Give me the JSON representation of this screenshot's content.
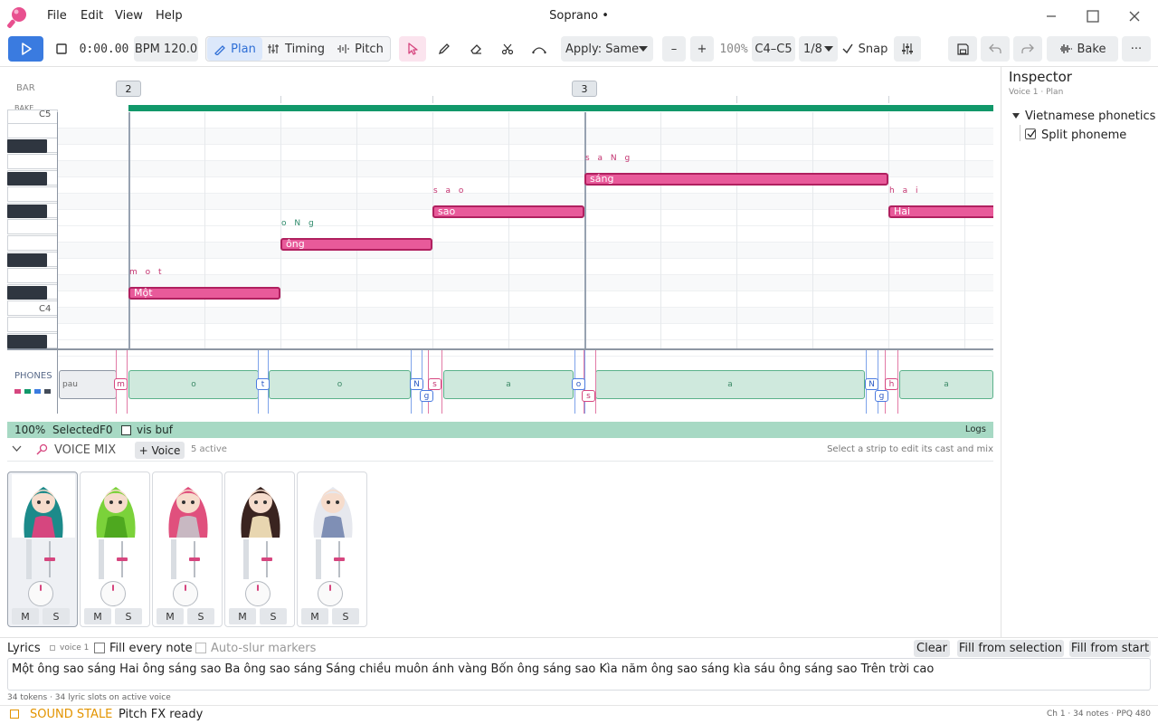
{
  "app": {
    "title": "Soprano •",
    "menu": [
      "File",
      "Edit",
      "View",
      "Help"
    ]
  },
  "toolbar": {
    "time": "0:00.00",
    "bpm": "BPM 120.0",
    "modes": [
      "Plan",
      "Timing",
      "Pitch"
    ],
    "active_mode": "Plan",
    "apply": "Apply: Same",
    "zoom_minus": "–",
    "zoom_plus": "+",
    "zoom": "100%",
    "range": "C4–C5",
    "division": "1/8",
    "snap_label": "Snap",
    "snap_checked": true,
    "bake_label": "Bake",
    "more": "···"
  },
  "icons": {
    "play": "play-icon",
    "stop": "stop-icon",
    "pointer": "pointer-icon",
    "pencil": "pencil-icon",
    "eraser": "eraser-icon",
    "scissors": "scissors-icon",
    "curve": "curve-icon",
    "sliders": "sliders-icon",
    "save": "save-icon",
    "undo": "undo-icon",
    "redo": "redo-icon",
    "waveform": "waveform-icon"
  },
  "colors": {
    "accent": "#3a7be0",
    "note": "#e85a9a",
    "note_border": "#b0205f",
    "bake_bar": "#11986a",
    "phone_fill": "#cfe9dd",
    "status_bar": "#a7d9c4",
    "stale": "#e39400"
  },
  "editor": {
    "bar_label": "BAR",
    "bake_label": "BAKE",
    "bar_numbers": [
      "2",
      "3"
    ],
    "key_labels": [
      "C5",
      "C4"
    ],
    "notes": [
      {
        "lyric": "Một",
        "phonemes": "m o t"
      },
      {
        "lyric": "ông",
        "phonemes": "o N g"
      },
      {
        "lyric": "sao",
        "phonemes": "s a o"
      },
      {
        "lyric": "sáng",
        "phonemes": "s a N g"
      },
      {
        "lyric": "Hai",
        "phonemes": "h a i"
      }
    ],
    "phones_label": "PHONES",
    "phones": {
      "pau": "pau",
      "m": "m",
      "o1": "o",
      "t": "t",
      "o2": "o",
      "N1": "N",
      "g1": "g",
      "s1": "s",
      "a1": "a",
      "o3": "o",
      "s2": "s",
      "a2": "a",
      "N2": "N",
      "g2": "g",
      "h": "h",
      "a3": "a"
    }
  },
  "status_strip": {
    "zoom": "100%",
    "selected": "SelectedF0",
    "vis_buf": "vis buf",
    "logs": "Logs"
  },
  "voice_mix": {
    "title": "VOICE MIX",
    "add_voice": "+ Voice",
    "active_count": "5 active",
    "hint": "Select a strip to edit its cast and mix",
    "strips": [
      {
        "mute": "M",
        "solo": "S",
        "hair": "#1c8a8a",
        "accent": "#d6467f"
      },
      {
        "mute": "M",
        "solo": "S",
        "hair": "#7bd23a",
        "accent": "#4ea81f"
      },
      {
        "mute": "M",
        "solo": "S",
        "hair": "#e0507d",
        "accent": "#c8b8c2"
      },
      {
        "mute": "M",
        "solo": "S",
        "hair": "#3a2420",
        "accent": "#e8d6b0"
      },
      {
        "mute": "M",
        "solo": "S",
        "hair": "#e6e8ee",
        "accent": "#7f8fb5"
      }
    ]
  },
  "lyrics": {
    "label": "Lyrics",
    "voice_tag": "voice 1",
    "fill_every_note": "Fill every note",
    "auto_slur": "Auto-slur markers",
    "clear": "Clear",
    "fill_selection": "Fill from selection",
    "fill_start": "Fill from start",
    "text": "Một ông sao sáng Hai ông sáng sao Ba ông sao sáng Sáng chiều muôn ánh vàng Bốn ông sáng sao Kìa năm ông sao sáng kìa sáu ông sáng sao Trên trời cao",
    "token_info": "34 tokens · 34 lyric slots on active voice"
  },
  "inspector": {
    "title": "Inspector",
    "subtitle": "Voice 1 · Plan",
    "section": "Vietnamese phonetics",
    "split_label": "Split phoneme",
    "split_checked": true
  },
  "statusbar": {
    "stale": "SOUND STALE",
    "pitch": "Pitch FX ready",
    "right": "Ch 1 · 34 notes · PPQ 480"
  }
}
